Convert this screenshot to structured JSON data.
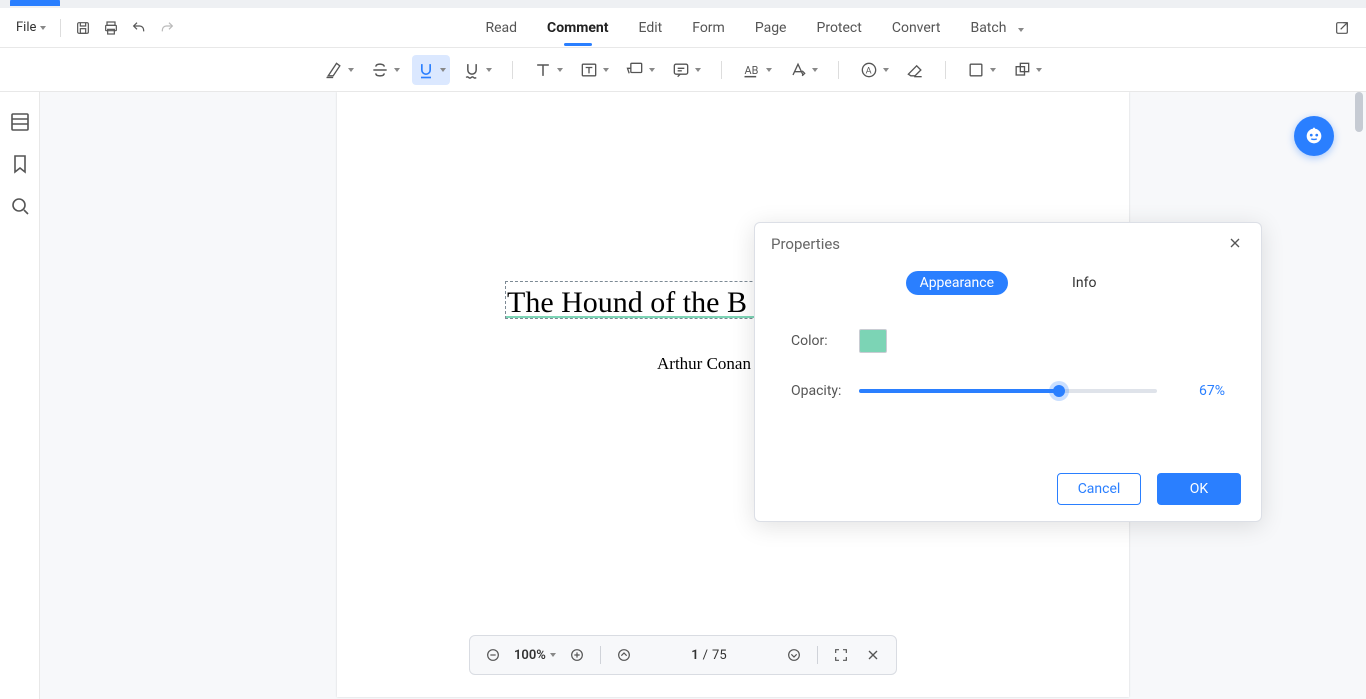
{
  "file_menu": {
    "label": "File"
  },
  "main_tabs": {
    "items": [
      {
        "label": "Read"
      },
      {
        "label": "Comment"
      },
      {
        "label": "Edit"
      },
      {
        "label": "Form"
      },
      {
        "label": "Page"
      },
      {
        "label": "Protect"
      },
      {
        "label": "Convert"
      },
      {
        "label": "Batch"
      }
    ],
    "active_index": 1
  },
  "document": {
    "title": "The Hound of the B",
    "author": "Arthur Conan Doy"
  },
  "dialog": {
    "title": "Properties",
    "tabs": {
      "appearance": "Appearance",
      "info": "Info"
    },
    "active_tab": "appearance",
    "color_label": "Color:",
    "color_value": "#7cd4b5",
    "opacity_label": "Opacity:",
    "opacity_percent": 67,
    "opacity_text": "67%",
    "cancel": "Cancel",
    "ok": "OK"
  },
  "bottom_bar": {
    "zoom": "100%",
    "current_page": "1",
    "total_pages": "75",
    "page_sep": "/"
  }
}
